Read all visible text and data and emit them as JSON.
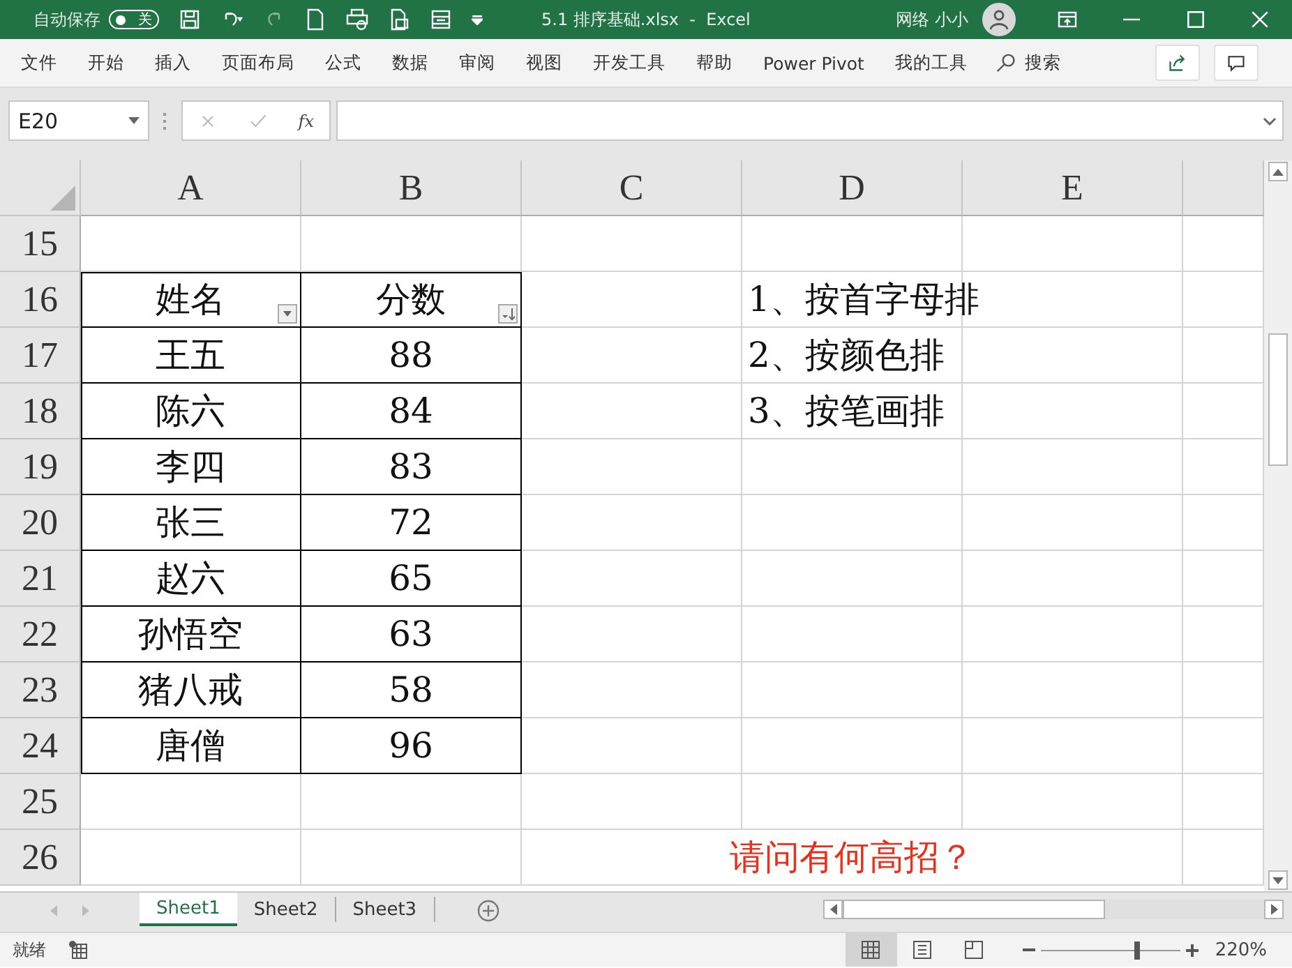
{
  "title_bar": {
    "autosave_label": "自动保存",
    "autosave_toggle": {
      "label": "关",
      "on": false
    },
    "redo_disabled": true,
    "title": "5.1 排序基础.xlsx  -  Excel",
    "user": "网络 小小"
  },
  "ribbon_tabs": [
    "文件",
    "开始",
    "插入",
    "页面布局",
    "公式",
    "数据",
    "审阅",
    "视图",
    "开发工具",
    "帮助",
    "Power Pivot",
    "我的工具"
  ],
  "search": {
    "label": "搜索"
  },
  "formula_bar": {
    "name_box": "E20",
    "fx": "fx"
  },
  "sheet": {
    "columns": [
      "A",
      "B",
      "C",
      "D",
      "E"
    ],
    "rows": [
      {
        "number": "15",
        "cells": []
      },
      {
        "number": "16",
        "cells": [
          {
            "text": "姓名",
            "boxed": true,
            "filter": true,
            "sorted": false
          },
          {
            "text": "分数",
            "boxed": true,
            "filter": true,
            "sorted": true
          },
          "",
          {
            "text": "1、按首字母排"
          }
        ]
      },
      {
        "number": "17",
        "cells": [
          {
            "text": "王五",
            "boxed": true
          },
          {
            "text": "88",
            "boxed": true
          },
          "",
          {
            "text": "2、按颜色排"
          }
        ]
      },
      {
        "number": "18",
        "cells": [
          {
            "text": "陈六",
            "boxed": true
          },
          {
            "text": "84",
            "boxed": true
          },
          "",
          {
            "text": "3、按笔画排"
          }
        ]
      },
      {
        "number": "19",
        "cells": [
          {
            "text": "李四",
            "boxed": true
          },
          {
            "text": "83",
            "boxed": true
          }
        ]
      },
      {
        "number": "20",
        "cells": [
          {
            "text": "张三",
            "boxed": true
          },
          {
            "text": "72",
            "boxed": true
          }
        ]
      },
      {
        "number": "21",
        "cells": [
          {
            "text": "赵六",
            "boxed": true
          },
          {
            "text": "65",
            "boxed": true
          }
        ]
      },
      {
        "number": "22",
        "cells": [
          {
            "text": "孙悟空",
            "boxed": true
          },
          {
            "text": "63",
            "boxed": true
          }
        ]
      },
      {
        "number": "23",
        "cells": [
          {
            "text": "猪八戒",
            "boxed": true
          },
          {
            "text": "58",
            "boxed": true
          }
        ]
      },
      {
        "number": "24",
        "cells": [
          {
            "text": "唐僧",
            "boxed": true
          },
          {
            "text": "96",
            "boxed": true
          }
        ]
      },
      {
        "number": "25",
        "cells": []
      },
      {
        "number": "26",
        "cells": [
          "",
          "",
          {
            "text": "请问有何高招？",
            "colspan": 3,
            "color": "#e8301c"
          }
        ]
      }
    ]
  },
  "sheet_tabs": [
    {
      "label": "Sheet1",
      "selected": true
    },
    {
      "label": "Sheet2",
      "selected": false
    },
    {
      "label": "Sheet3",
      "selected": false
    }
  ],
  "status_bar": {
    "status": "就绪",
    "zoom": {
      "level": 0.69,
      "reading": "220%"
    }
  }
}
